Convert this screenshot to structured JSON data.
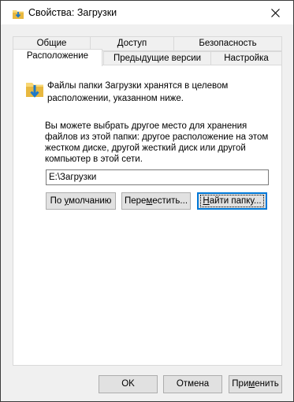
{
  "window": {
    "title": "Свойства: Загрузки"
  },
  "tabs": {
    "row1": [
      "Общие",
      "Доступ",
      "Безопасность"
    ],
    "row2": [
      "Расположение",
      "Предыдущие версии",
      "Настройка"
    ],
    "active": "Расположение"
  },
  "panel": {
    "info": "Файлы папки Загрузки хранятся в целевом расположении, указанном ниже.",
    "description": "Вы можете выбрать другое место для хранения файлов из этой папки: другое расположение на этом жестком диске, другой жесткий диск или другой компьютер в этой сети.",
    "path_value": "E:\\Загрузки",
    "buttons": {
      "default": {
        "pre": "По ",
        "u": "у",
        "post": "молчанию"
      },
      "move": {
        "pre": "Пере",
        "u": "м",
        "post": "естить..."
      },
      "find": {
        "pre": "",
        "u": "Н",
        "post": "айти папку..."
      }
    }
  },
  "footer": {
    "ok": "OK",
    "cancel": "Отмена",
    "apply": {
      "pre": "При",
      "u": "м",
      "post": "енить"
    }
  },
  "colors": {
    "accent": "#0078d7",
    "folder": "#f8d775",
    "arrow": "#1e78c8"
  }
}
